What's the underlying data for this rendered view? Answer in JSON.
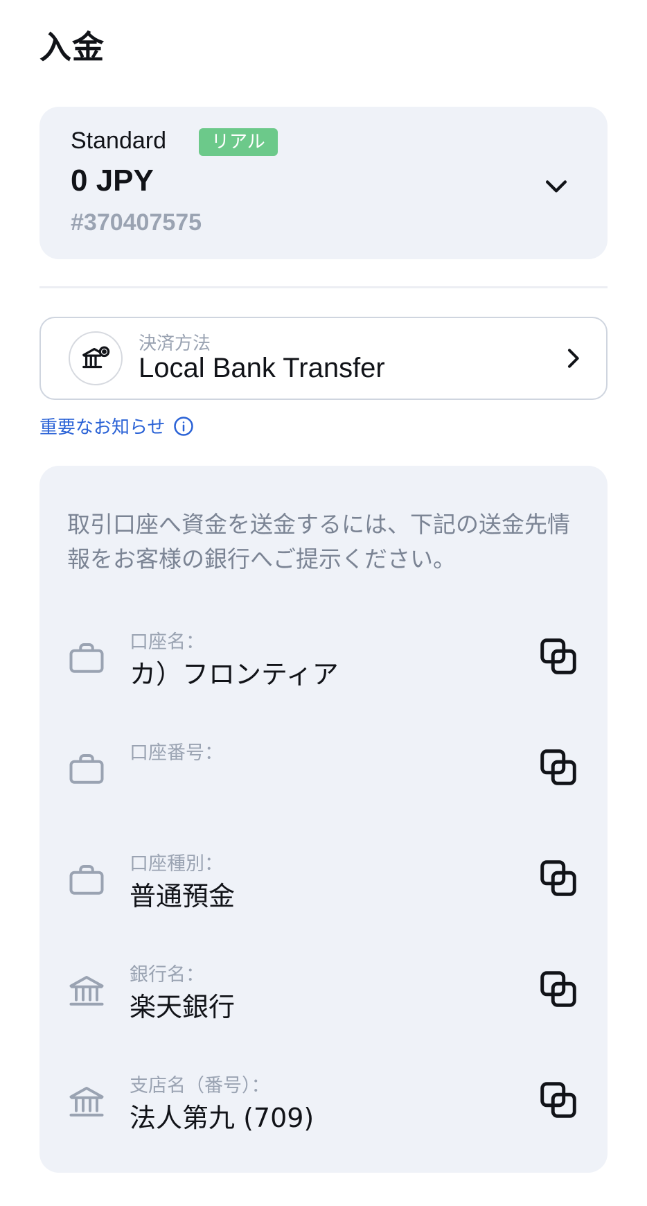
{
  "page": {
    "title": "入金"
  },
  "account": {
    "type": "Standard",
    "badge": "リアル",
    "balance": "0 JPY",
    "id": "#370407575"
  },
  "payment_method": {
    "label": "決済方法",
    "value": "Local Bank Transfer"
  },
  "notice": {
    "label": "重要なお知らせ"
  },
  "details": {
    "instruction": "取引口座へ資金を送金するには、下記の送金先情報をお客様の銀行へご提示ください。",
    "rows": [
      {
        "icon": "briefcase-icon",
        "label": "口座名：",
        "value": "カ）フロンティア"
      },
      {
        "icon": "briefcase-icon",
        "label": "口座番号：",
        "value": ""
      },
      {
        "icon": "briefcase-icon",
        "label": "口座種別：",
        "value": "普通預金"
      },
      {
        "icon": "bank-icon",
        "label": "銀行名：",
        "value": "楽天銀行"
      },
      {
        "icon": "bank-icon",
        "label": "支店名（番号）：",
        "value": "法人第九 (709)"
      }
    ]
  },
  "colors": {
    "card_bg": "#eff2f8",
    "badge_bg": "#6cc98a",
    "link": "#2a62d6",
    "muted_text": "#9aa3b2"
  }
}
